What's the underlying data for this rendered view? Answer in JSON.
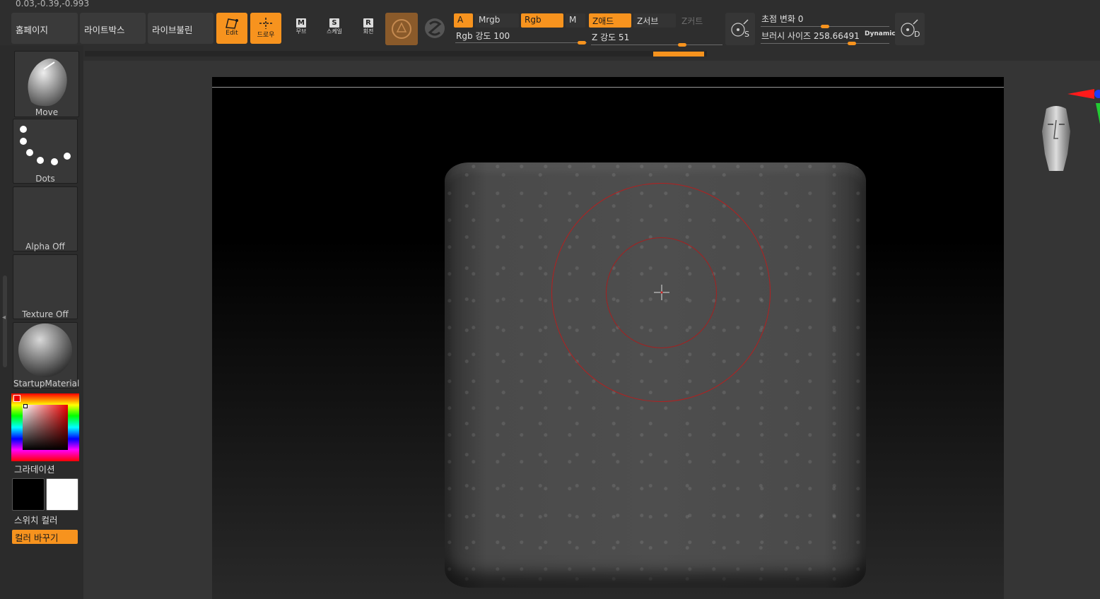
{
  "status": {
    "coords": "0.03,-0.39,-0.993"
  },
  "top_buttons": {
    "home": "홈페이지",
    "lightbox": "라이트박스",
    "liveboolean": "라이브불린"
  },
  "modes": {
    "edit": "Edit",
    "draw": "드로우"
  },
  "tools": {
    "move": "무브",
    "move_key": "M",
    "scale": "스케일",
    "scale_key": "S",
    "rotate": "회전",
    "rotate_key": "R"
  },
  "options": {
    "a": "A",
    "mrgb": "Mrgb",
    "rgb": "Rgb",
    "m": "M",
    "zadd": "Z애드",
    "zsub": "Z서브",
    "zcut": "Z커트",
    "rgb_intensity": "Rgb 강도 100",
    "z_intensity": "Z 강도 51",
    "rgb_intensity_value": 100,
    "z_intensity_value": 51
  },
  "brush": {
    "focal_shift": "초점 변화 0",
    "focal_shift_value": 0,
    "size": "브러시 사이즈 258.66491",
    "size_value": 258.66491,
    "dynamic": "Dynamic",
    "s_key": "S",
    "d_key": "D"
  },
  "left_panel": {
    "brush": "Move",
    "stroke": "Dots",
    "alpha": "Alpha Off",
    "texture": "Texture Off",
    "material": "StartupMaterial",
    "gradient": "그라데이션",
    "switch_color": "스위치 컬러",
    "swap_color": "컬러 바꾸기"
  },
  "colors": {
    "accent": "#f7931e",
    "primary_color": "#000000",
    "secondary_color": "#ffffff",
    "brush_ring": "#b32020"
  }
}
